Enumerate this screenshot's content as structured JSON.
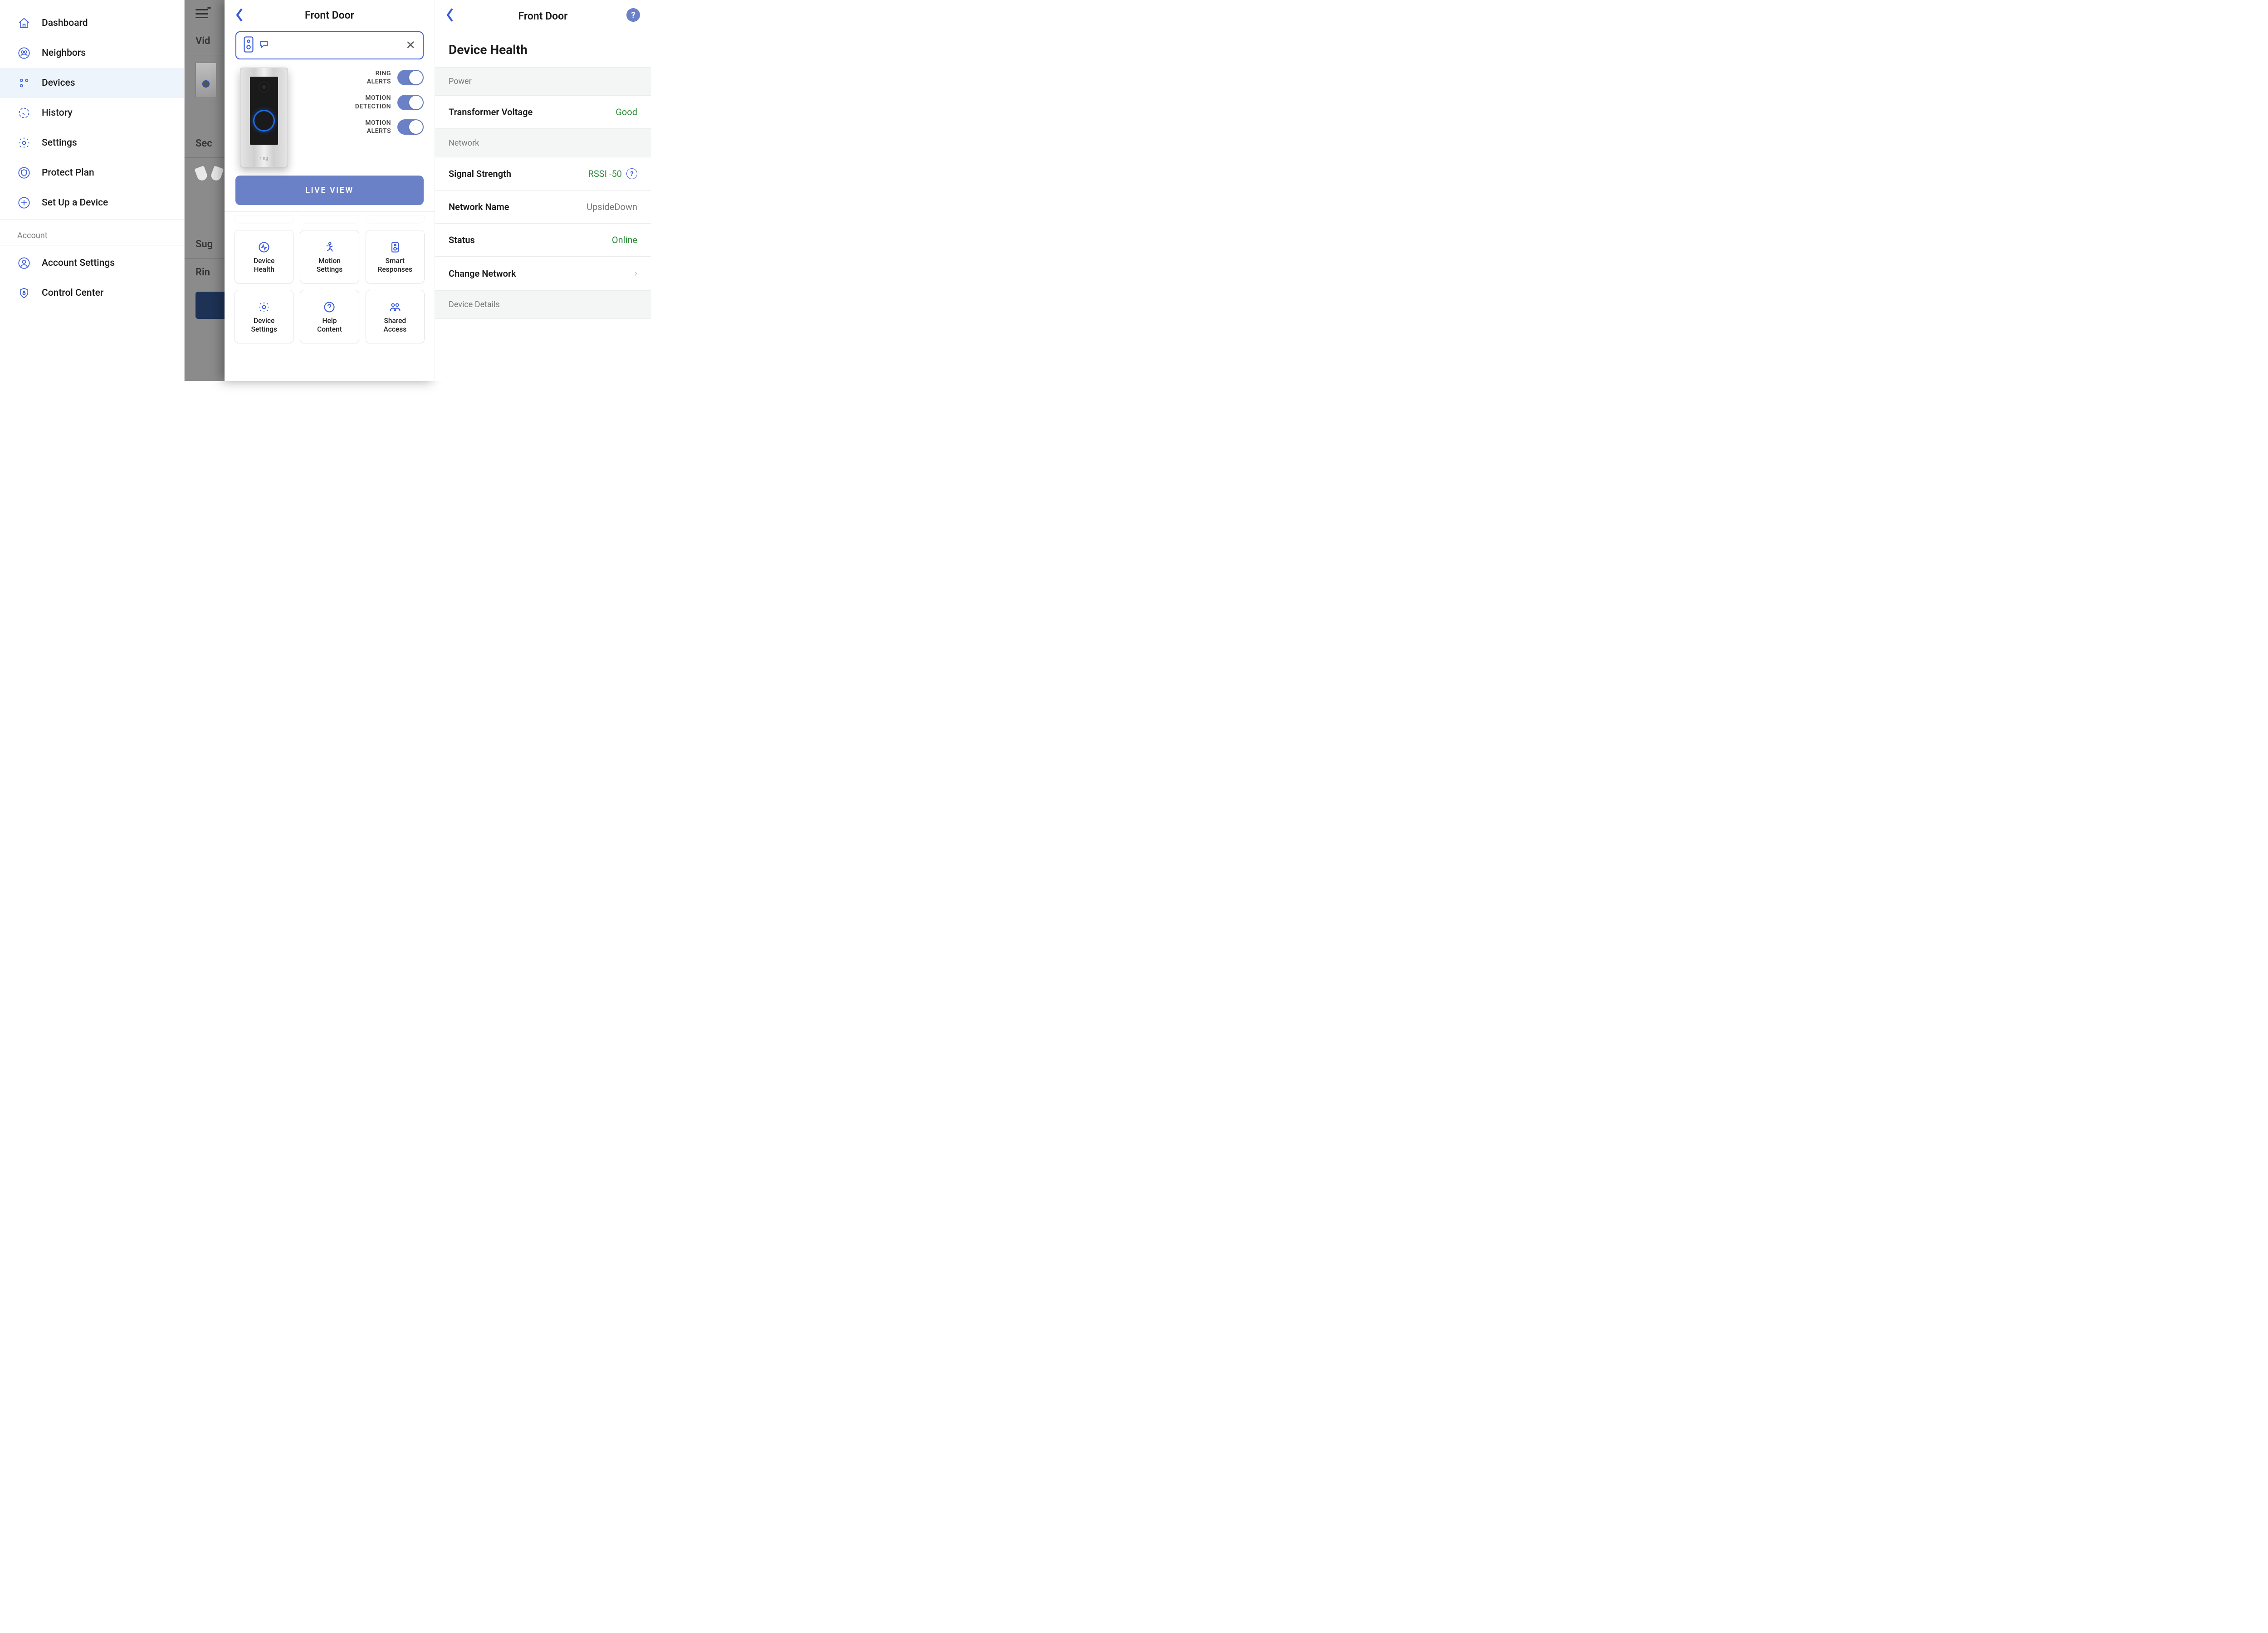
{
  "sidebar": {
    "items": [
      {
        "label": "Dashboard",
        "icon": "home",
        "active": false
      },
      {
        "label": "Neighbors",
        "icon": "neighbors",
        "active": false
      },
      {
        "label": "Devices",
        "icon": "devices",
        "active": true
      },
      {
        "label": "History",
        "icon": "history",
        "active": false
      },
      {
        "label": "Settings",
        "icon": "gear",
        "active": false
      },
      {
        "label": "Protect Plan",
        "icon": "shield",
        "active": false
      },
      {
        "label": "Set Up a Device",
        "icon": "plus",
        "active": false
      }
    ],
    "account_section_label": "Account",
    "account_items": [
      {
        "label": "Account Settings",
        "icon": "user"
      },
      {
        "label": "Control Center",
        "icon": "shield-lock"
      }
    ]
  },
  "backdrop": {
    "section1": "Vid",
    "section2": "Sec",
    "section3": "Sug",
    "section4": "Rin"
  },
  "device": {
    "title": "Front Door",
    "brand": "ring",
    "toggles": {
      "ring_alerts_label": "RING\nALERTS",
      "motion_detection_label": "MOTION\nDETECTION",
      "motion_alerts_label": "MOTION\nALERTS",
      "ring_alerts_on": true,
      "motion_detection_on": true,
      "motion_alerts_on": true
    },
    "live_view_label": "LIVE VIEW",
    "tiles": [
      {
        "label": "Device\nHealth",
        "icon": "health"
      },
      {
        "label": "Motion\nSettings",
        "icon": "motion"
      },
      {
        "label": "Smart\nResponses",
        "icon": "smart"
      },
      {
        "label": "Device\nSettings",
        "icon": "gear"
      },
      {
        "label": "Help\nContent",
        "icon": "help"
      },
      {
        "label": "Shared\nAccess",
        "icon": "shared"
      }
    ]
  },
  "health": {
    "title": "Front Door",
    "heading": "Device Health",
    "sections": {
      "power": {
        "label": "Power",
        "rows": [
          {
            "label": "Transformer Voltage",
            "value": "Good",
            "good": true
          }
        ]
      },
      "network": {
        "label": "Network",
        "rows": [
          {
            "label": "Signal Strength",
            "value": "RSSI -50",
            "good": true,
            "help": true
          },
          {
            "label": "Network Name",
            "value": "UpsideDown"
          },
          {
            "label": "Status",
            "value": "Online",
            "good": true
          },
          {
            "label": "Change Network",
            "chevron": true
          }
        ]
      },
      "details": {
        "label": "Device Details"
      }
    }
  }
}
